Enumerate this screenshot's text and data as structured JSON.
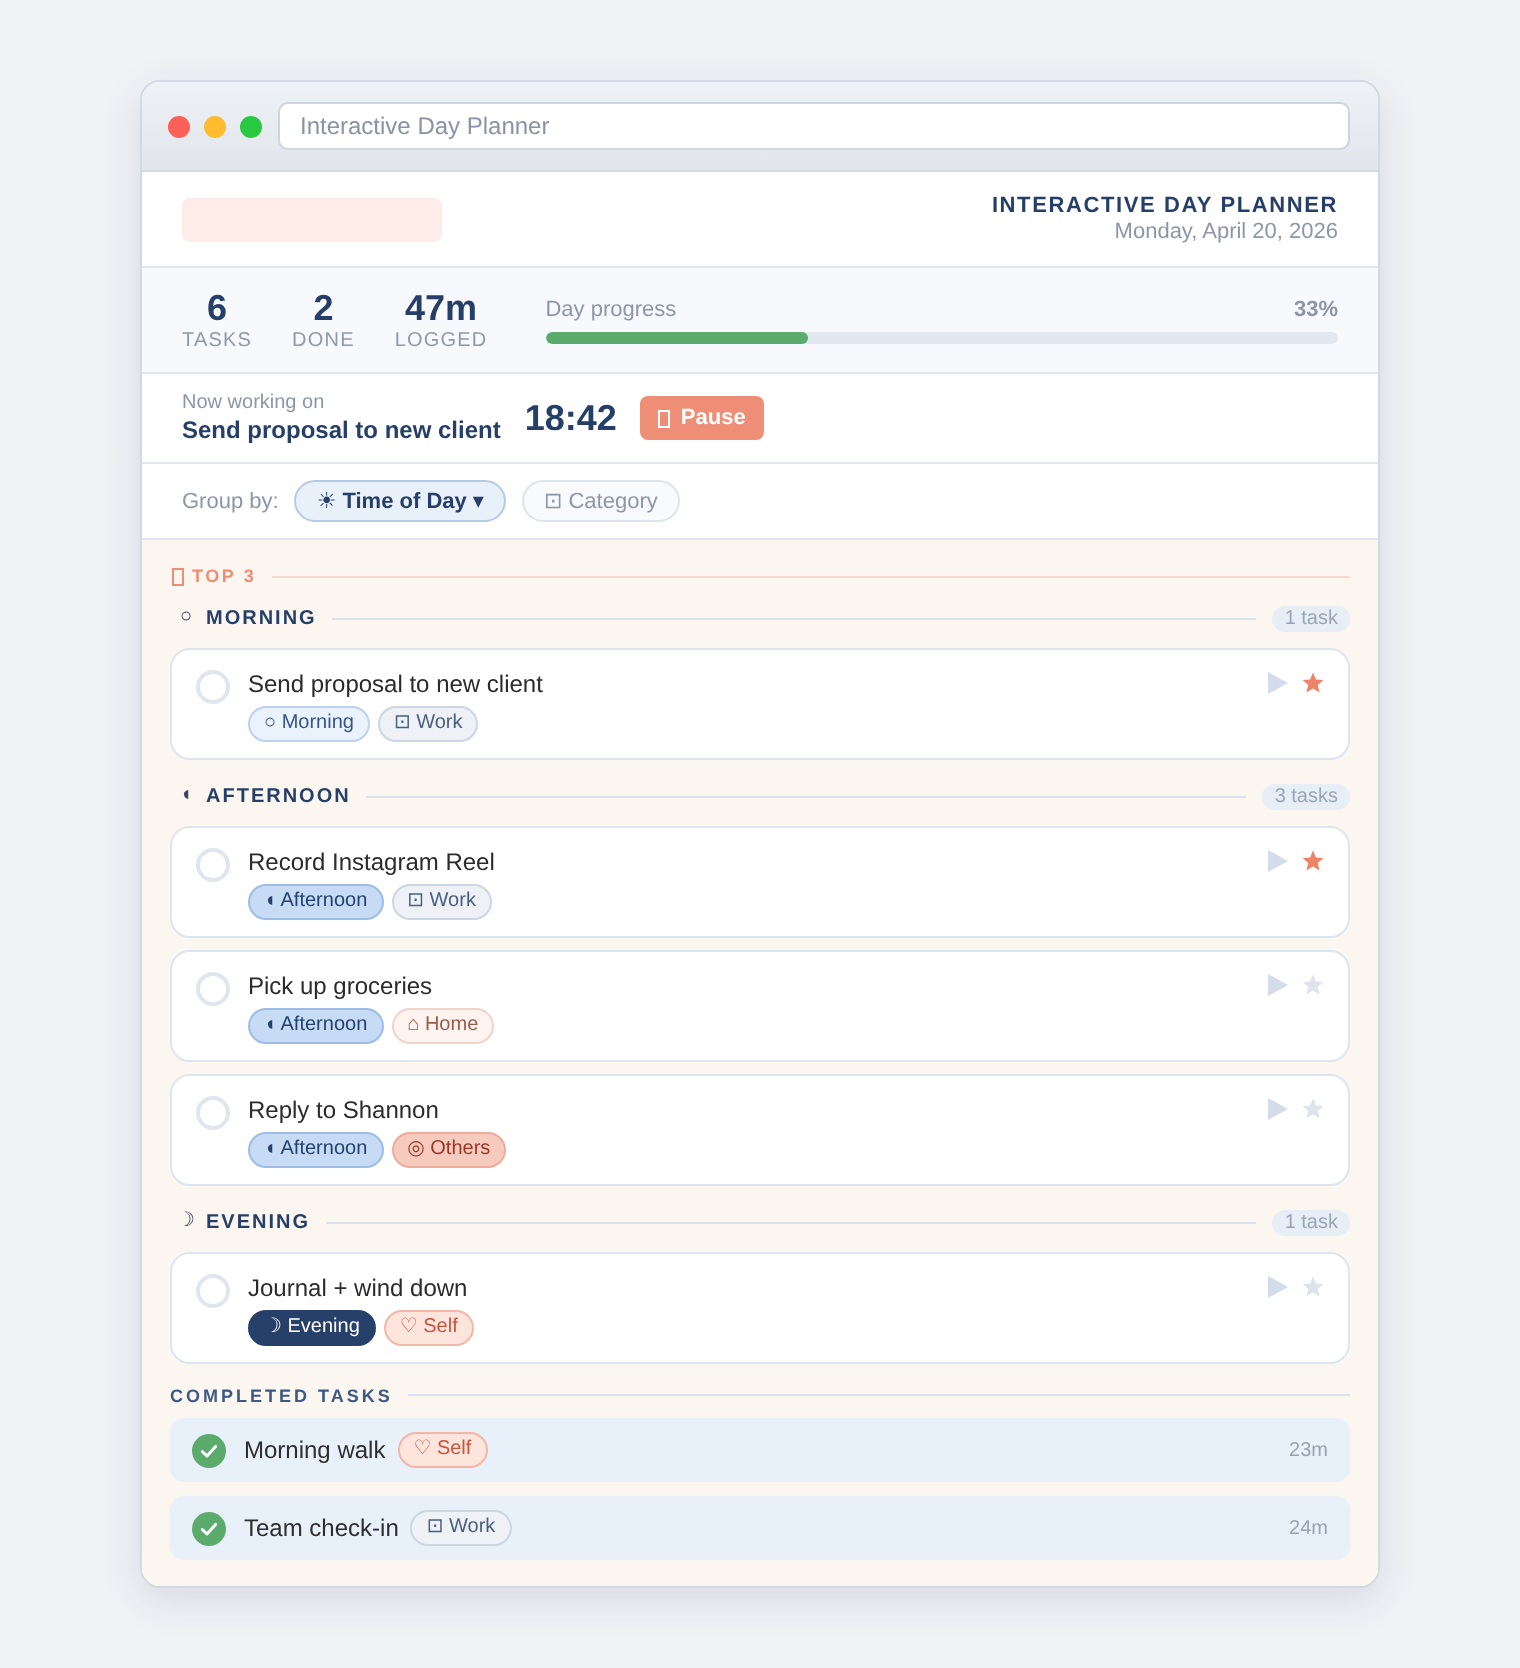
{
  "window": {
    "address": "Interactive Day Planner"
  },
  "header": {
    "title": "INTERACTIVE DAY PLANNER",
    "date": "Monday, April 20, 2026"
  },
  "stats": [
    {
      "value": "6",
      "label": "TASKS"
    },
    {
      "value": "2",
      "label": "DONE"
    },
    {
      "value": "47m",
      "label": "LOGGED"
    }
  ],
  "progress": {
    "label": "Day progress",
    "reading": "33%",
    "level": 0.33
  },
  "now_working": {
    "caption": "Now working on",
    "task": "Send proposal to new client",
    "timer": "18:42",
    "button": "Pause"
  },
  "group_by": {
    "label": "Group by:",
    "options": [
      {
        "label": "☀ Time of Day ▾",
        "selected": true
      },
      {
        "label": "⊡ Category",
        "selected": false
      }
    ]
  },
  "sections": [
    {
      "kind": "top",
      "title": "TOP 3"
    },
    {
      "kind": "morning",
      "icon": "○",
      "title": "MORNING",
      "count": "1 task",
      "tasks": [
        {
          "title": "Send proposal to new client",
          "checked": false,
          "starred": true,
          "tags": [
            {
              "kind": "morning",
              "label": "○ Morning"
            },
            {
              "kind": "work",
              "label": "⊡ Work"
            }
          ]
        }
      ]
    },
    {
      "kind": "afternoon",
      "icon": "◖",
      "title": "AFTERNOON",
      "count": "3 tasks",
      "tasks": [
        {
          "title": "Record Instagram Reel",
          "checked": false,
          "starred": true,
          "tags": [
            {
              "kind": "afternoon",
              "label": "◖ Afternoon"
            },
            {
              "kind": "work",
              "label": "⊡ Work"
            }
          ]
        },
        {
          "title": "Pick up groceries",
          "checked": false,
          "starred": false,
          "tags": [
            {
              "kind": "afternoon",
              "label": "◖ Afternoon"
            },
            {
              "kind": "home",
              "label": "⌂ Home"
            }
          ]
        },
        {
          "title": "Reply to Shannon",
          "checked": false,
          "starred": false,
          "tags": [
            {
              "kind": "afternoon",
              "label": "◖ Afternoon"
            },
            {
              "kind": "others",
              "label": "◎ Others"
            }
          ]
        }
      ]
    },
    {
      "kind": "evening",
      "icon": "☽",
      "title": "EVENING",
      "count": "1 task",
      "tasks": [
        {
          "title": "Journal + wind down",
          "checked": false,
          "starred": false,
          "tags": [
            {
              "kind": "evening",
              "label": "☽ Evening"
            },
            {
              "kind": "self",
              "label": "♡ Self"
            }
          ]
        }
      ]
    }
  ],
  "completed": {
    "title": "COMPLETED TASKS",
    "items": [
      {
        "title": "Morning walk",
        "checked": true,
        "tag": {
          "kind": "self",
          "label": "♡ Self"
        },
        "time": "23m"
      },
      {
        "title": "Team check-in",
        "checked": true,
        "tag": {
          "kind": "work",
          "label": "⊡ Work"
        },
        "time": "24m"
      }
    ]
  }
}
